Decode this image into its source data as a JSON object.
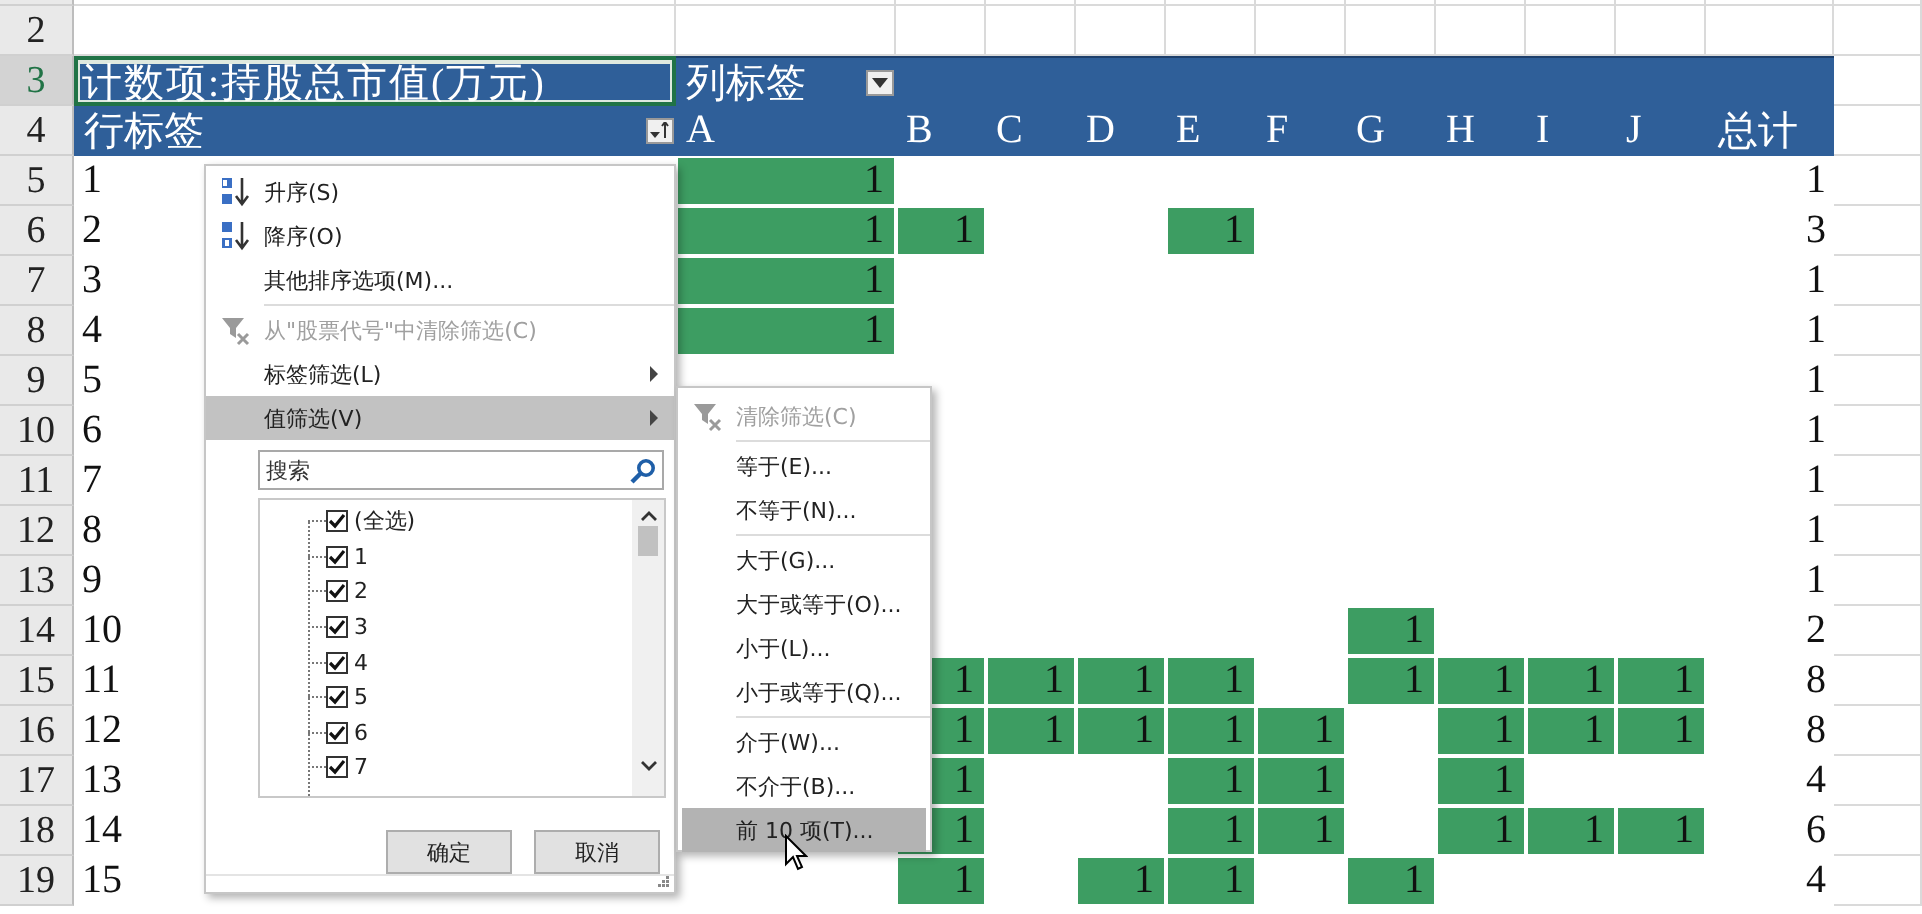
{
  "row_headers": [
    {
      "label": "2",
      "selected": false
    },
    {
      "label": "3",
      "selected": true
    },
    {
      "label": "4",
      "selected": false
    },
    {
      "label": "5",
      "selected": false
    },
    {
      "label": "6",
      "selected": false
    },
    {
      "label": "7",
      "selected": false
    },
    {
      "label": "8",
      "selected": false
    },
    {
      "label": "9",
      "selected": false
    },
    {
      "label": "10",
      "selected": false
    },
    {
      "label": "11",
      "selected": false
    },
    {
      "label": "12",
      "selected": false
    },
    {
      "label": "13",
      "selected": false
    },
    {
      "label": "14",
      "selected": false
    },
    {
      "label": "15",
      "selected": false
    },
    {
      "label": "16",
      "selected": false
    },
    {
      "label": "17",
      "selected": false
    },
    {
      "label": "18",
      "selected": false
    },
    {
      "label": "19",
      "selected": false
    }
  ],
  "pivot": {
    "title": "计数项:持股总市值(万元)",
    "column_label": "列标签",
    "row_label": "行标签",
    "columns": [
      "A",
      "B",
      "C",
      "D",
      "E",
      "F",
      "G",
      "H",
      "I",
      "J"
    ],
    "total_header": "总计",
    "rows": [
      {
        "label": "1",
        "cells": [
          "1",
          null,
          null,
          null,
          null,
          null,
          null,
          null,
          null,
          null
        ],
        "total": "1"
      },
      {
        "label": "2",
        "cells": [
          "1",
          "1",
          null,
          null,
          "1",
          null,
          null,
          null,
          null,
          null
        ],
        "total": "3"
      },
      {
        "label": "3",
        "cells": [
          "1",
          null,
          null,
          null,
          null,
          null,
          null,
          null,
          null,
          null
        ],
        "total": "1"
      },
      {
        "label": "4",
        "cells": [
          "1",
          null,
          null,
          null,
          null,
          null,
          null,
          null,
          null,
          null
        ],
        "total": "1"
      },
      {
        "label": "5",
        "cells": [
          null,
          null,
          null,
          null,
          null,
          null,
          null,
          null,
          null,
          null
        ],
        "total": "1"
      },
      {
        "label": "6",
        "cells": [
          null,
          null,
          null,
          null,
          null,
          null,
          null,
          null,
          null,
          null
        ],
        "total": "1"
      },
      {
        "label": "7",
        "cells": [
          null,
          null,
          null,
          null,
          null,
          null,
          null,
          null,
          null,
          null
        ],
        "total": "1"
      },
      {
        "label": "8",
        "cells": [
          null,
          null,
          null,
          null,
          null,
          null,
          null,
          null,
          null,
          null
        ],
        "total": "1"
      },
      {
        "label": "9",
        "cells": [
          null,
          null,
          null,
          null,
          null,
          null,
          null,
          null,
          null,
          null
        ],
        "total": "1"
      },
      {
        "label": "10",
        "cells": [
          null,
          null,
          null,
          null,
          null,
          null,
          "1",
          null,
          null,
          null
        ],
        "total": "2"
      },
      {
        "label": "11",
        "cells": [
          null,
          "1",
          "1",
          "1",
          "1",
          null,
          "1",
          "1",
          "1",
          "1"
        ],
        "total": "8"
      },
      {
        "label": "12",
        "cells": [
          null,
          "1",
          "1",
          "1",
          "1",
          "1",
          null,
          "1",
          "1",
          "1"
        ],
        "total": "8"
      },
      {
        "label": "13",
        "cells": [
          null,
          "1",
          null,
          null,
          "1",
          "1",
          null,
          "1",
          null,
          null
        ],
        "total": "4"
      },
      {
        "label": "14",
        "cells": [
          null,
          "1",
          null,
          null,
          "1",
          "1",
          null,
          "1",
          "1",
          "1"
        ],
        "total": "6"
      },
      {
        "label": "15",
        "cells": [
          null,
          "1",
          null,
          "1",
          "1",
          null,
          "1",
          null,
          null,
          null
        ],
        "total": "4"
      }
    ]
  },
  "filter_menu": {
    "items": [
      {
        "kind": "sort_ascending",
        "label": "升序(S)",
        "disabled": false,
        "selected": false
      },
      {
        "kind": "sort_descending",
        "label": "降序(O)",
        "disabled": false,
        "selected": false
      },
      {
        "kind": "command",
        "label": "其他排序选项(M)...",
        "disabled": false,
        "selected": false
      },
      {
        "kind": "separator"
      },
      {
        "kind": "clear_filter",
        "label": "从\"股票代号\"中清除筛选(C)",
        "disabled": true,
        "selected": false
      },
      {
        "kind": "submenu",
        "label": "标签筛选(L)",
        "disabled": false,
        "selected": false
      },
      {
        "kind": "submenu",
        "label": "值筛选(V)",
        "disabled": false,
        "selected": true
      }
    ],
    "search": {
      "placeholder": "搜索"
    },
    "checklist": [
      {
        "label": "(全选)",
        "checked": true
      },
      {
        "label": "1",
        "checked": true
      },
      {
        "label": "2",
        "checked": true
      },
      {
        "label": "3",
        "checked": true
      },
      {
        "label": "4",
        "checked": true
      },
      {
        "label": "5",
        "checked": true
      },
      {
        "label": "6",
        "checked": true
      },
      {
        "label": "7",
        "checked": true
      }
    ],
    "buttons": [
      "确定",
      "取消"
    ]
  },
  "value_filter_menu": {
    "items": [
      {
        "kind": "clear_filter",
        "label": "清除筛选(C)",
        "disabled": true,
        "selected": false
      },
      {
        "kind": "separator"
      },
      {
        "kind": "command",
        "label": "等于(E)...",
        "disabled": false,
        "selected": false
      },
      {
        "kind": "command",
        "label": "不等于(N)...",
        "disabled": false,
        "selected": false
      },
      {
        "kind": "separator"
      },
      {
        "kind": "command",
        "label": "大于(G)...",
        "disabled": false,
        "selected": false
      },
      {
        "kind": "command",
        "label": "大于或等于(O)...",
        "disabled": false,
        "selected": false
      },
      {
        "kind": "command",
        "label": "小于(L)...",
        "disabled": false,
        "selected": false
      },
      {
        "kind": "command",
        "label": "小于或等于(Q)...",
        "disabled": false,
        "selected": false
      },
      {
        "kind": "separator"
      },
      {
        "kind": "command",
        "label": "介于(W)...",
        "disabled": false,
        "selected": false
      },
      {
        "kind": "command",
        "label": "不介于(B)...",
        "disabled": false,
        "selected": false
      },
      {
        "kind": "command",
        "label": "前 10 项(T)...",
        "disabled": false,
        "selected": true
      }
    ]
  }
}
